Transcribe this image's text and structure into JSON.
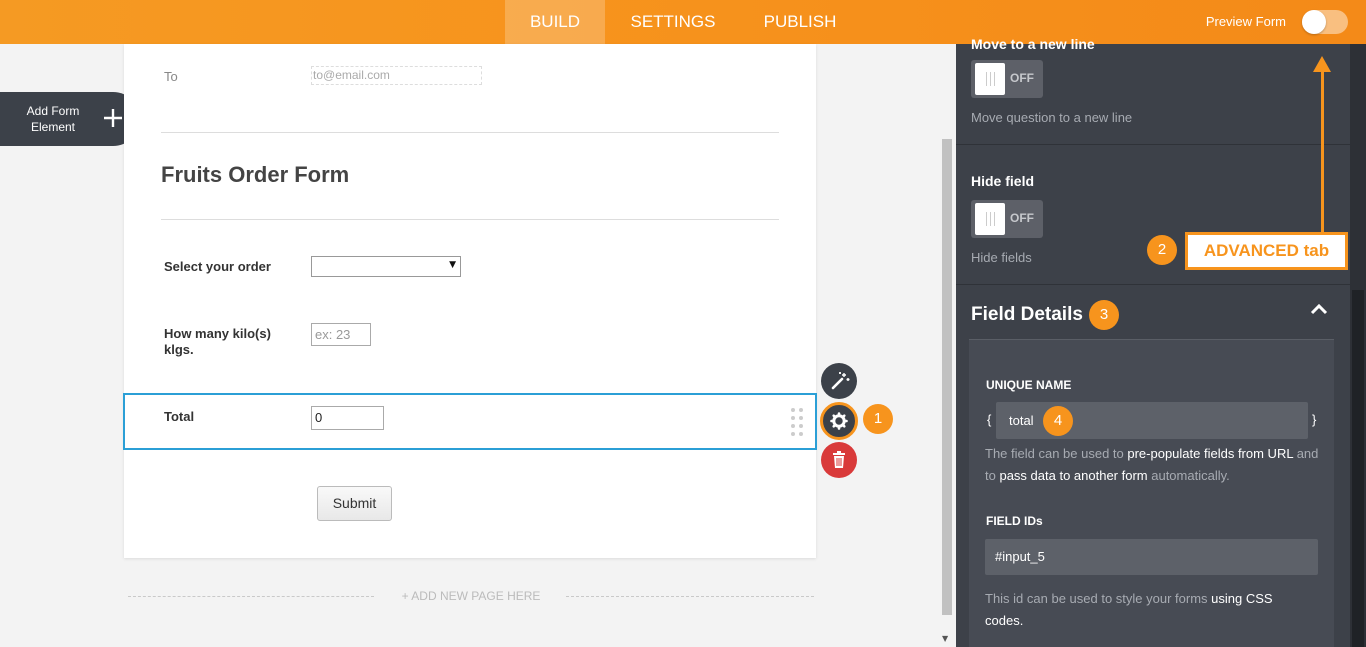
{
  "topbar": {
    "tabs": [
      {
        "label": "BUILD",
        "active": true
      },
      {
        "label": "SETTINGS",
        "active": false
      },
      {
        "label": "PUBLISH",
        "active": false
      }
    ],
    "preview_label": "Preview Form",
    "accent": "#f7941d"
  },
  "sidebar": {
    "add_element_label": "Add Form Element",
    "add_icon": "plus-icon"
  },
  "form": {
    "to_label": "To",
    "to_placeholder": "to@email.com",
    "heading": "Fruits Order Form",
    "select_label": "Select your order",
    "kilos_label": "How many kilo(s) klgs.",
    "kilos_placeholder": "ex: 23",
    "total_label": "Total",
    "total_value": "0",
    "submit_label": "Submit",
    "add_page_label": "+ ADD NEW PAGE HERE"
  },
  "actions": {
    "wand_icon": "wand-icon",
    "gear_icon": "gear-icon",
    "trash_icon": "trash-icon",
    "badge_1": "1"
  },
  "panel": {
    "cutoff_title": "Move to a new line",
    "toggle_off": "OFF",
    "move_hint": "Move question to a new line",
    "hide_title": "Hide field",
    "hide_hint": "Hide fields",
    "badge_2": "2",
    "field_details_title": "Field Details",
    "badge_3": "3",
    "unique_name_title": "UNIQUE NAME",
    "brace_open": "{",
    "brace_close": "}",
    "unique_name_value": "total",
    "badge_4": "4",
    "unique_desc_1": "The field can be used to ",
    "unique_desc_2": "pre-populate fields from URL",
    "unique_desc_3": " and to ",
    "unique_desc_4": "pass data to another form",
    "unique_desc_5": " automatically.",
    "field_ids_title": "FIELD IDs",
    "field_id_value": "#input_5",
    "id_desc_1": "This id can be used to style your forms ",
    "id_desc_2": "using CSS codes."
  },
  "annotation": {
    "label": "ADVANCED tab"
  }
}
